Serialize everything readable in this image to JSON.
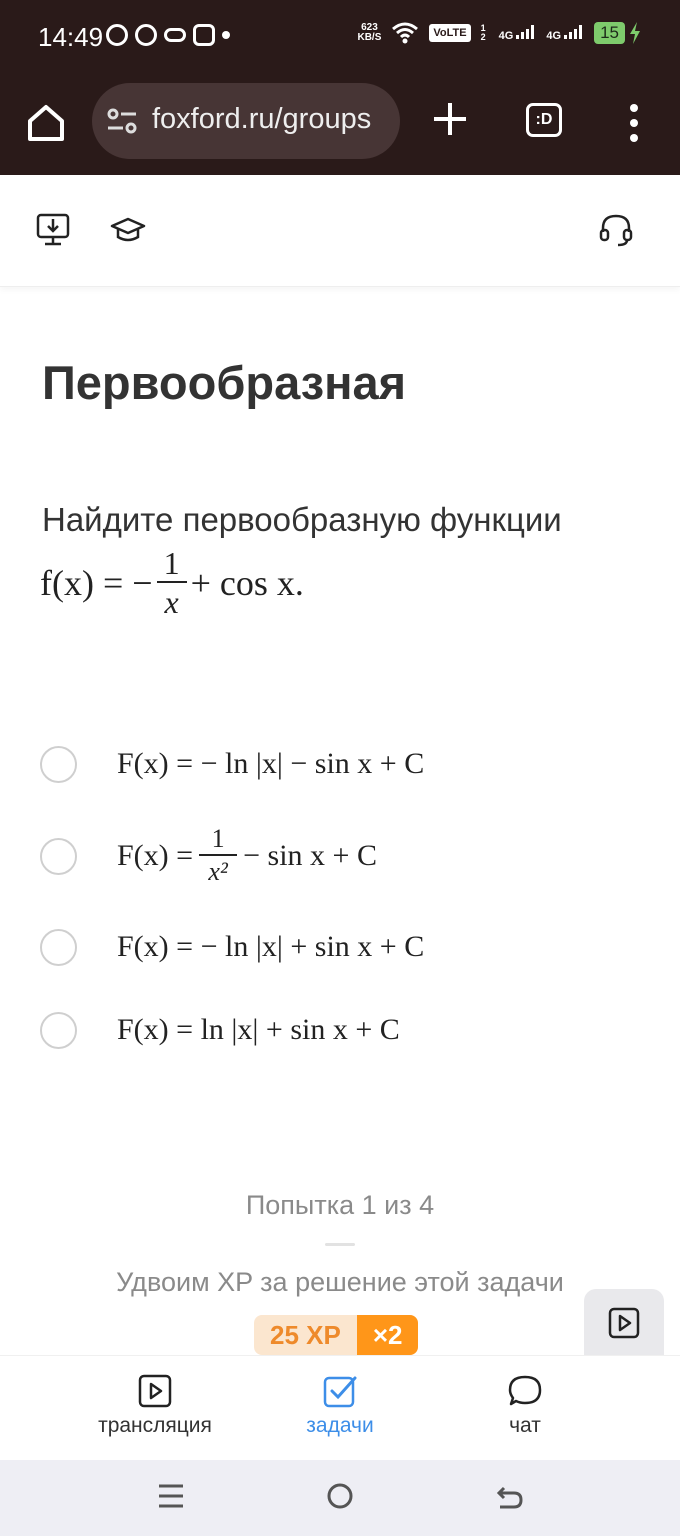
{
  "status_bar": {
    "time": "14:49",
    "net_speed_value": "623",
    "net_speed_unit": "KB/S",
    "volte": "VoLTE",
    "sim1": "4G",
    "sim2": "4G",
    "sim_index": "1 2",
    "battery": "15"
  },
  "browser": {
    "url": "foxford.ru/groups",
    "tabs_label": ":D"
  },
  "page": {
    "title": "Первообразная",
    "question": "Найдите первообразную функции",
    "formula": {
      "lhs": "f(x) = −",
      "frac_num": "1",
      "frac_den": "x",
      "rhs": "+ cos x."
    },
    "options": [
      {
        "text": "F(x) = − ln |x| − sin x + C"
      },
      {
        "lhs": "F(x) =",
        "frac_num": "1",
        "frac_den": "x²",
        "rhs": "− sin x + C"
      },
      {
        "text": "F(x) = − ln |x| + sin x + C"
      },
      {
        "text": "F(x) = ln |x| + sin x + C"
      }
    ],
    "attempt": "Попытка 1 из 4",
    "xp_text": "Удвоим XP за решение этой задачи",
    "xp_value": "25 XP",
    "xp_multiplier": "×2"
  },
  "bottom_nav": {
    "items": [
      {
        "label": "трансляция",
        "icon": "play-square-icon"
      },
      {
        "label": "задачи",
        "icon": "check-square-icon",
        "active": true
      },
      {
        "label": "чат",
        "icon": "chat-bubble-icon"
      }
    ]
  },
  "colors": {
    "browser_bar": "#2a1a19",
    "accent_blue": "#3d8ee8",
    "xp_orange": "#ff9619"
  }
}
